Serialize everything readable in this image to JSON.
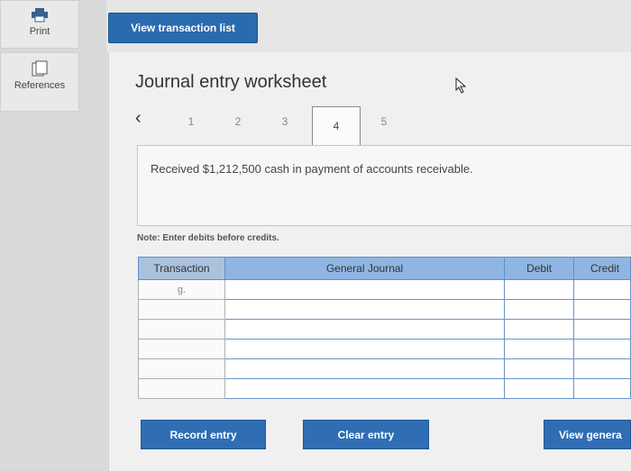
{
  "sidebar": {
    "print_label": "Print",
    "references_label": "References"
  },
  "toolbar": {
    "view_list_label": "View transaction list"
  },
  "worksheet": {
    "title": "Journal entry worksheet",
    "pages": [
      "1",
      "2",
      "3",
      "4",
      "5"
    ],
    "active_page": "4",
    "description": "Received $1,212,500 cash in payment of accounts receivable.",
    "note": "Note: Enter debits before credits."
  },
  "table": {
    "headers": {
      "transaction": "Transaction",
      "journal": "General Journal",
      "debit": "Debit",
      "credit": "Credit"
    },
    "rows": [
      {
        "transaction": "g."
      },
      {
        "transaction": ""
      },
      {
        "transaction": ""
      },
      {
        "transaction": ""
      },
      {
        "transaction": ""
      },
      {
        "transaction": ""
      }
    ]
  },
  "buttons": {
    "record": "Record entry",
    "clear": "Clear entry",
    "view_general": "View genera"
  },
  "colors": {
    "button_blue": "#2f6db4",
    "header_blue": "#8fb6e3"
  }
}
